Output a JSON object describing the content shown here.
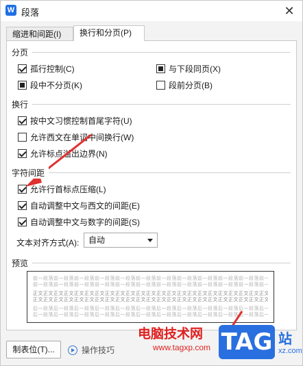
{
  "window": {
    "app_icon": "W",
    "title": "段落",
    "close_glyph": "✕"
  },
  "tabs": [
    {
      "label": "缩进和间距(I)",
      "active": false
    },
    {
      "label": "换行和分页(P)",
      "active": true
    }
  ],
  "pagination": {
    "title": "分页",
    "items": [
      {
        "label": "孤行控制(C)",
        "state": "checked"
      },
      {
        "label": "与下段同页(X)",
        "state": "indeterminate"
      },
      {
        "label": "段中不分页(K)",
        "state": "indeterminate"
      },
      {
        "label": "段前分页(B)",
        "state": "unchecked"
      }
    ]
  },
  "line_break": {
    "title": "换行",
    "items": [
      {
        "label": "按中文习惯控制首尾字符(U)",
        "state": "checked"
      },
      {
        "label": "允许西文在单词中间换行(W)",
        "state": "unchecked"
      },
      {
        "label": "允许标点溢出边界(N)",
        "state": "checked"
      }
    ]
  },
  "char_spacing": {
    "title": "字符间距",
    "items": [
      {
        "label": "允许行首标点压缩(L)",
        "state": "checked"
      },
      {
        "label": "自动调整中文与西文的间距(E)",
        "state": "checked"
      },
      {
        "label": "自动调整中文与数字的间距(S)",
        "state": "checked"
      }
    ],
    "align_label": "文本对齐方式(A):",
    "align_value": "自动"
  },
  "preview": {
    "title": "预览",
    "prev_text": "前一段落前一段落前一段落前一段落前一段落前一段落前一段落前一段落前一段落前一段落前一段落前一段落前一段落",
    "cur_text": "正文正文正文正文正文正文正文正文正文正文正文正文正文正文正文正文正文正文正文正文正文正文正文正文正文",
    "next_text": "后一段落后一段落后一段落后一段落后一段落后一段落后一段落后一段落后一段落后一段落后一段落后一段落后一段落"
  },
  "footer": {
    "tabs_button": "制表位(T)...",
    "tips_label": "操作技巧"
  },
  "watermark": {
    "site_name": "电脑技术网",
    "site_url": "www.tagxp.com",
    "tag": "TAG",
    "suffix": "站",
    "suffix_url": "xz.com"
  },
  "colors": {
    "accent": "#2a6fe0",
    "annotation_arrow": "#e03030"
  }
}
